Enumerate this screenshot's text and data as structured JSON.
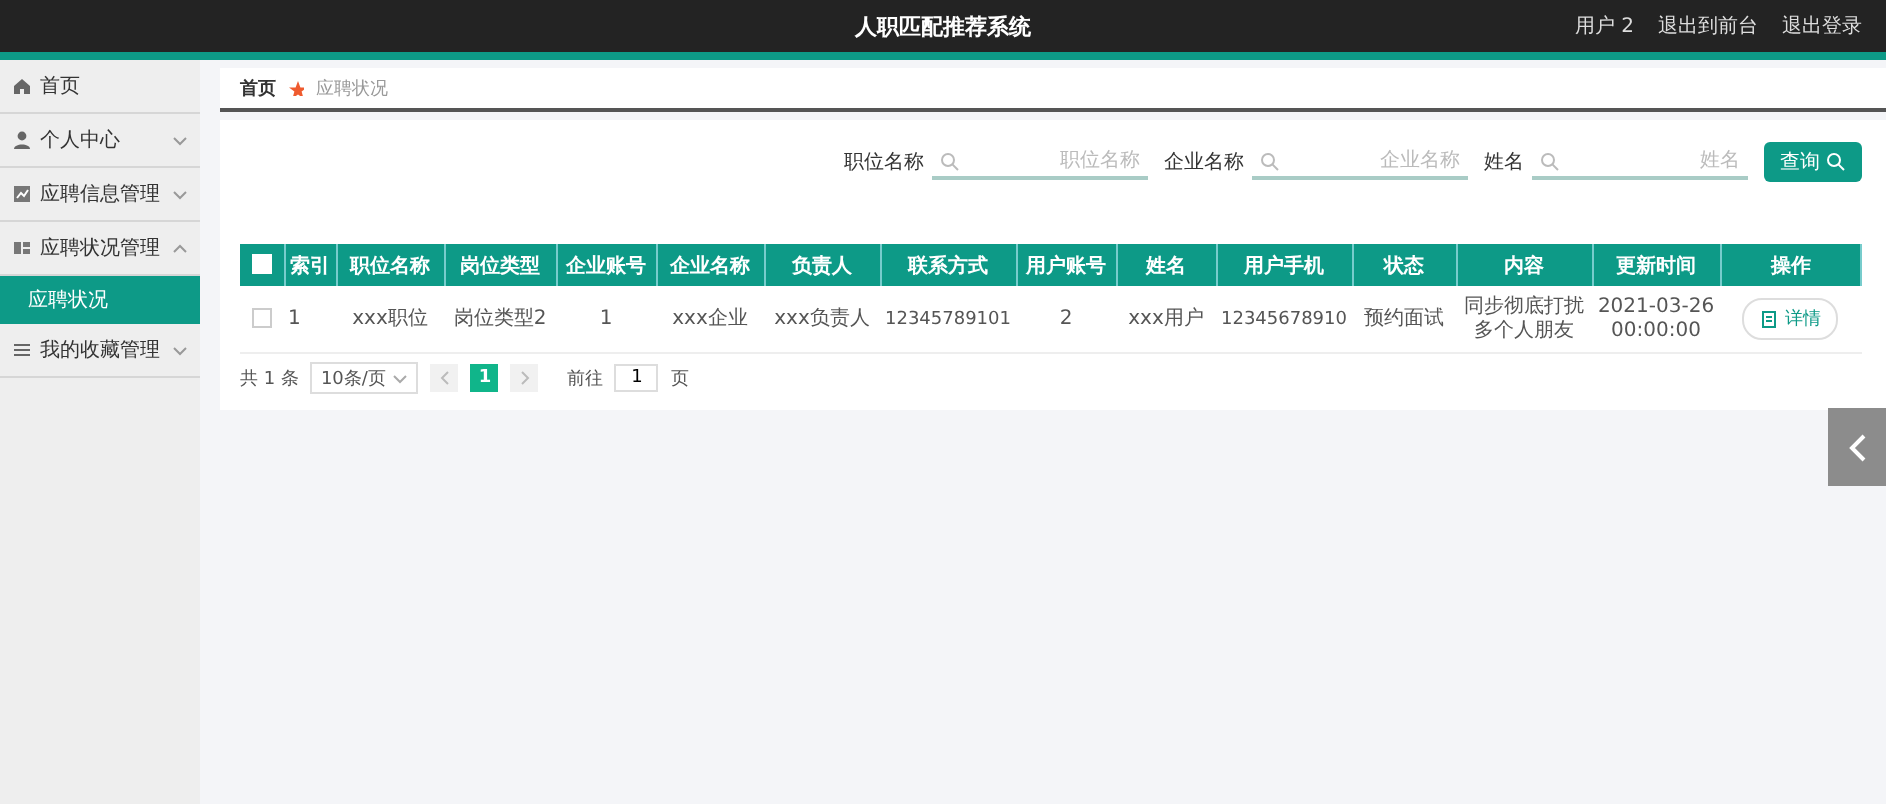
{
  "header": {
    "title": "人职匹配推荐系统",
    "links": [
      "用户 2",
      "退出到前台",
      "退出登录"
    ]
  },
  "sidebar": {
    "items": [
      {
        "label": "首页"
      },
      {
        "label": "个人中心",
        "expanded": false
      },
      {
        "label": "应聘信息管理",
        "expanded": false
      },
      {
        "label": "应聘状况管理",
        "expanded": true,
        "children": [
          {
            "label": "应聘状况",
            "selected": true
          }
        ]
      },
      {
        "label": "我的收藏管理",
        "expanded": false
      }
    ]
  },
  "breadcrumb": [
    "首页",
    "应聘状况"
  ],
  "search": {
    "fields": [
      {
        "label": "职位名称",
        "placeholder": "职位名称"
      },
      {
        "label": "企业名称",
        "placeholder": "企业名称"
      },
      {
        "label": "姓名",
        "placeholder": "姓名"
      }
    ],
    "button": "查询"
  },
  "table": {
    "select_all": {
      "checked": false
    },
    "columns": [
      "索引",
      "职位名称",
      "岗位类型",
      "企业账号",
      "企业名称",
      "负责人",
      "联系方式",
      "用户账号",
      "姓名",
      "用户手机",
      "状态",
      "内容",
      "更新时间",
      "操作"
    ],
    "rows": [
      {
        "checked": false,
        "cells": [
          "1",
          "xxx职位",
          "岗位类型2",
          "1",
          "xxx企业",
          "xxx负责人",
          "12345789101",
          "2",
          "xxx用户",
          "12345678910",
          "预约面试",
          "同步彻底打扰多个人朋友",
          "2021-03-26 00:00:00"
        ],
        "action": "详情"
      }
    ]
  },
  "pagination": {
    "total": "共 1 条",
    "page_size": "10条/页",
    "pages": [
      {
        "label": "1",
        "selected": true
      }
    ],
    "goto_label": "前往",
    "goto_value": "1",
    "goto_suffix": "页"
  }
}
